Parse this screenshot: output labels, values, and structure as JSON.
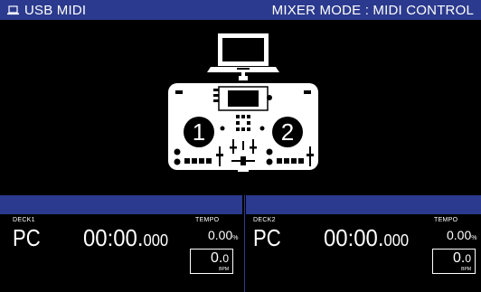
{
  "header": {
    "source_label": "USB MIDI",
    "mode_label": "MIXER MODE : MIDI CONTROL"
  },
  "illustration": {
    "deck1_number": "1",
    "deck2_number": "2"
  },
  "decks": [
    {
      "label": "DECK1",
      "tempo_label": "TEMPO",
      "source": "PC",
      "time_main": "00:00.",
      "time_ms": "000",
      "tempo_value": "0.00",
      "tempo_unit": "%",
      "bpm_int": "0.",
      "bpm_dec": "0",
      "bpm_label": "BPM"
    },
    {
      "label": "DECK2",
      "tempo_label": "TEMPO",
      "source": "PC",
      "time_main": "00:00.",
      "time_ms": "000",
      "tempo_value": "0.00",
      "tempo_unit": "%",
      "bpm_int": "0.",
      "bpm_dec": "0",
      "bpm_label": "BPM"
    }
  ],
  "colors": {
    "accent_bar": "#2b3a8e",
    "background": "#000000",
    "foreground": "#ffffff"
  }
}
